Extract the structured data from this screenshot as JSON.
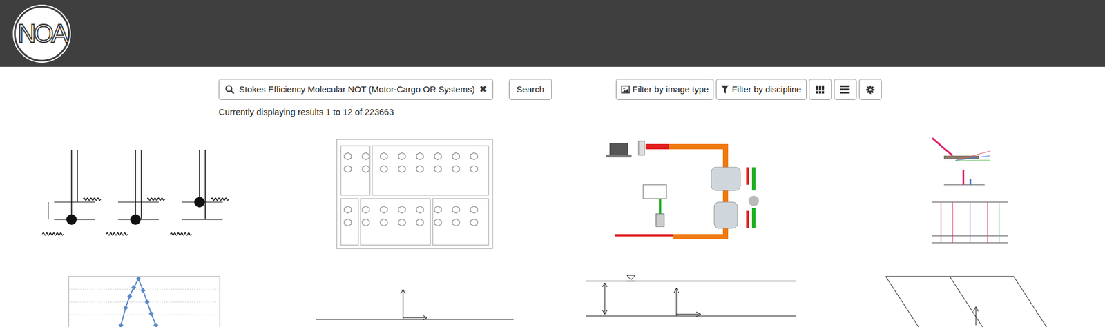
{
  "logo": "NOA",
  "search": {
    "value": "Stokes Efficiency Molecular NOT (Motor-Cargo OR Systems)",
    "clear": "✖",
    "button": "Search"
  },
  "filters": [
    {
      "label": "Filter by image type"
    },
    {
      "label": "Filter by discipline"
    }
  ],
  "results_summary": "Currently displaying results 1 to 12 of 223663",
  "results": [
    {
      "kind": "energy-levels"
    },
    {
      "kind": "structures"
    },
    {
      "kind": "setup"
    },
    {
      "kind": "scattering"
    },
    {
      "kind": "plot"
    },
    {
      "kind": "axes"
    },
    {
      "kind": "channel"
    },
    {
      "kind": "parallelogram"
    }
  ]
}
